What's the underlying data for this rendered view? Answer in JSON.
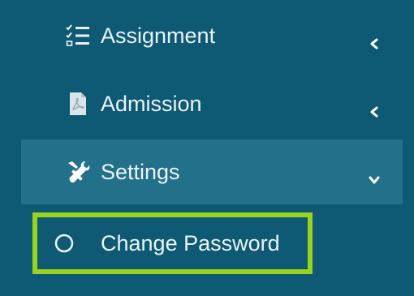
{
  "sidebar": {
    "items": [
      {
        "label": "Assignment",
        "icon": "list-check-icon",
        "chevron": "chevron-left-icon"
      },
      {
        "label": "Admission",
        "icon": "pdf-file-icon",
        "chevron": "chevron-left-icon"
      },
      {
        "label": "Settings",
        "icon": "tools-icon",
        "chevron": "chevron-down-icon",
        "expanded": true
      }
    ],
    "submenu": [
      {
        "label": "Change Password",
        "icon": "circle-outline-icon",
        "highlighted": true
      }
    ]
  },
  "colors": {
    "sidebar_bg": "#0e5a74",
    "active_bg": "#22708a",
    "text": "#eaf3f7",
    "highlight_border": "#9bd21c"
  }
}
